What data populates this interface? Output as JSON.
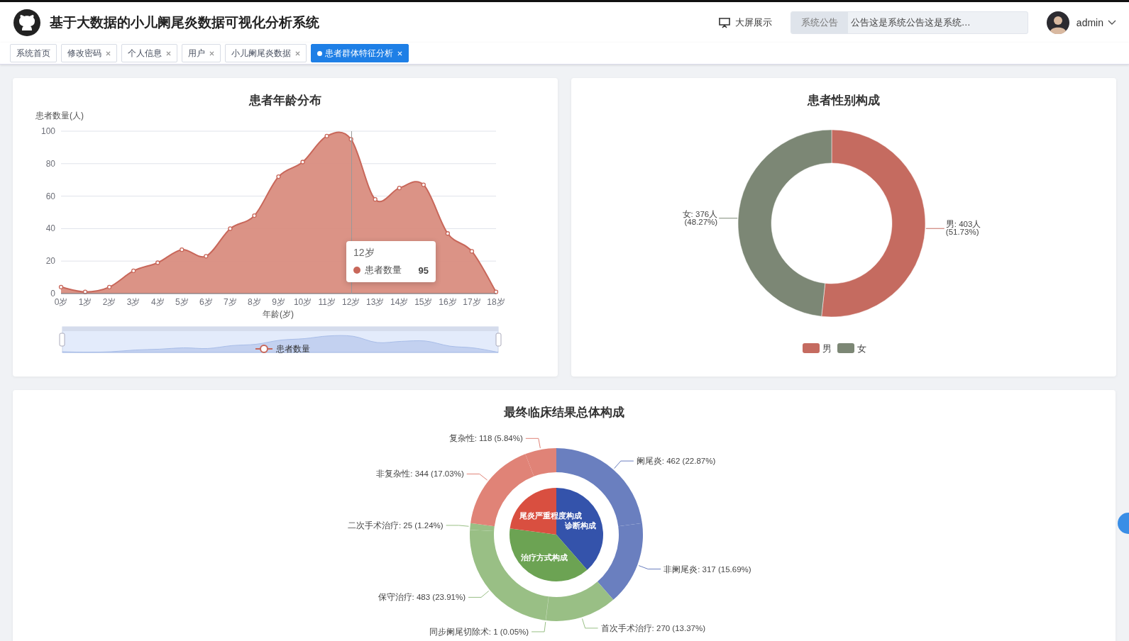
{
  "header": {
    "title": "基于大数据的小儿阑尾炎数据可视化分析系统",
    "big_screen": "大屏展示",
    "notice": {
      "label": "系统公告",
      "text": "公告这是系统公告这是系统…"
    },
    "user": "admin"
  },
  "tabs": [
    {
      "label": "系统首页",
      "closable": false,
      "selected": false
    },
    {
      "label": "修改密码",
      "closable": true,
      "selected": false
    },
    {
      "label": "个人信息",
      "closable": true,
      "selected": false
    },
    {
      "label": "用户",
      "closable": true,
      "selected": false
    },
    {
      "label": "小儿阑尾炎数据",
      "closable": true,
      "selected": false
    },
    {
      "label": "患者群体特征分析",
      "closable": true,
      "selected": true
    }
  ],
  "age_chart": {
    "title": "患者年龄分布",
    "tooltip": {
      "title": "12岁",
      "series": "患者数量",
      "value": "95"
    },
    "chart_data": {
      "type": "area",
      "xlabel": "年龄(岁)",
      "ylabel": "患者数量(人)",
      "grid": true,
      "legend": true,
      "categories": [
        "0岁",
        "1岁",
        "2岁",
        "3岁",
        "4岁",
        "5岁",
        "6岁",
        "7岁",
        "8岁",
        "9岁",
        "10岁",
        "11岁",
        "12岁",
        "13岁",
        "14岁",
        "15岁",
        "16岁",
        "17岁",
        "18岁"
      ],
      "ylim": [
        0,
        100
      ],
      "yticks": [
        0,
        20,
        40,
        60,
        80,
        100
      ],
      "series": [
        {
          "name": "患者数量",
          "color": "#c8675a",
          "values": [
            4,
            1,
            4,
            14,
            19,
            27,
            23,
            40,
            48,
            72,
            81,
            97,
            95,
            58,
            65,
            67,
            37,
            26,
            1
          ]
        }
      ]
    }
  },
  "gender_chart": {
    "title": "患者性别构成",
    "chart_data": {
      "type": "donut",
      "legend": true,
      "categories": [
        "男",
        "女"
      ],
      "values": [
        51.73,
        48.27
      ],
      "colors": [
        "#c56b60",
        "#7c8775"
      ],
      "value_labels": [
        [
          "男: 403人",
          "(51.73%)"
        ],
        [
          "女: 376人",
          "(48.27%)"
        ]
      ]
    }
  },
  "outcome_chart": {
    "title": "最终临床结果总体构成",
    "outer_ring": {
      "chart_data": {
        "type": "donut",
        "values": [
          462,
          317,
          270,
          1,
          483,
          25,
          344,
          118
        ],
        "colors": [
          "#6a7fbf",
          "#6a7fbf",
          "#99bf85",
          "#99bf85",
          "#99bf85",
          "#99bf85",
          "#e08377",
          "#e08377"
        ],
        "value_labels": [
          "阑尾炎: 462 (22.87%)",
          "非阑尾炎: 317 (15.69%)",
          "首次手术治疗: 270 (13.37%)",
          "同步阑尾切除术: 1 (0.05%)",
          "保守治疗: 483 (23.91%)",
          "二次手术治疗: 25 (1.24%)",
          "非复杂性: 344 (17.03%)",
          "复杂性: 118 (5.84%)"
        ]
      }
    },
    "inner_ring": {
      "chart_data": {
        "type": "pie",
        "categories": [
          "诊断构成",
          "治疗方式构成",
          "尾炎严重程度构成"
        ],
        "values": [
          38.57,
          38.56,
          22.87
        ],
        "colors": [
          "#3453ab",
          "#6ca353",
          "#d94f40"
        ]
      }
    }
  }
}
